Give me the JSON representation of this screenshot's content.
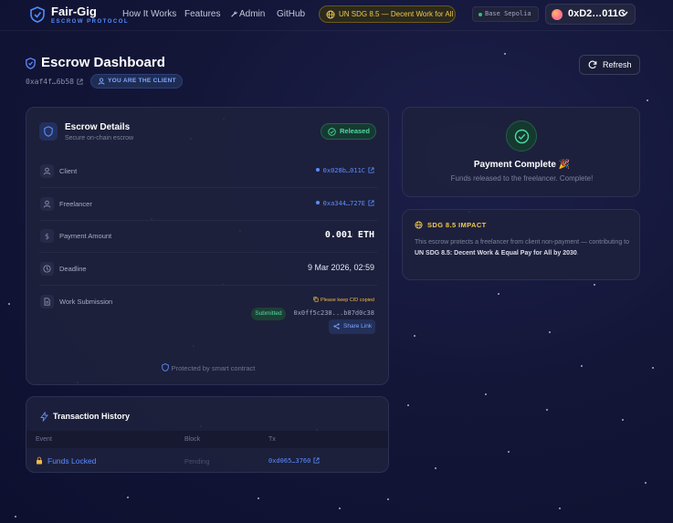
{
  "nav": {
    "brand": "Fair-Gig",
    "brand_sub": "ESCROW PROTOCOL",
    "links": [
      "How It Works",
      "Features",
      "Admin",
      "GitHub"
    ],
    "sdg_badge": "UN SDG 8.5 — Decent Work for All",
    "network": "Base Sepolia",
    "wallet": "0xD2…011C"
  },
  "header": {
    "title": "Escrow Dashboard",
    "escrow_address": "0xaf4f…6b58",
    "role_badge": "YOU ARE THE CLIENT",
    "refresh_label": "Refresh"
  },
  "details": {
    "title": "Escrow Details",
    "subtitle": "Secure on-chain escrow",
    "status": "Released",
    "client_label": "Client",
    "client_value": "0x028b…011C",
    "freelancer_label": "Freelancer",
    "freelancer_value": "0xa344…727E",
    "amount_label": "Payment Amount",
    "amount_value": "0.001 ETH",
    "deadline_label": "Deadline",
    "deadline_value": "9 Mar 2026, 02:59",
    "submission_label": "Work Submission",
    "cid_note": "Please keep CID copied",
    "submission_status": "Submitted",
    "cid_value": "0x0ff5c238...b87d0c38",
    "share_label": "Share Link",
    "footer": "Protected by smart contract"
  },
  "payment": {
    "title": "Payment Complete 🎉",
    "subtitle": "Funds released to the freelancer. Complete!"
  },
  "impact": {
    "title": "SDG 8.5 IMPACT",
    "text_a": "This escrow protects a freelancer from client non-payment — contributing to ",
    "text_b": "UN SDG 8.5: Decent Work & Equal Pay for All by 2030",
    "text_c": "."
  },
  "history": {
    "title": "Transaction History",
    "columns": [
      "Event",
      "Block",
      "Tx"
    ],
    "rows": [
      {
        "event": "Funds Locked",
        "block": "Pending",
        "tx": "0xd065…3760"
      }
    ]
  },
  "colors": {
    "accent": "#5b8dff",
    "success": "#4ed9a0",
    "warning": "#f2c94c",
    "background": "#141638"
  }
}
